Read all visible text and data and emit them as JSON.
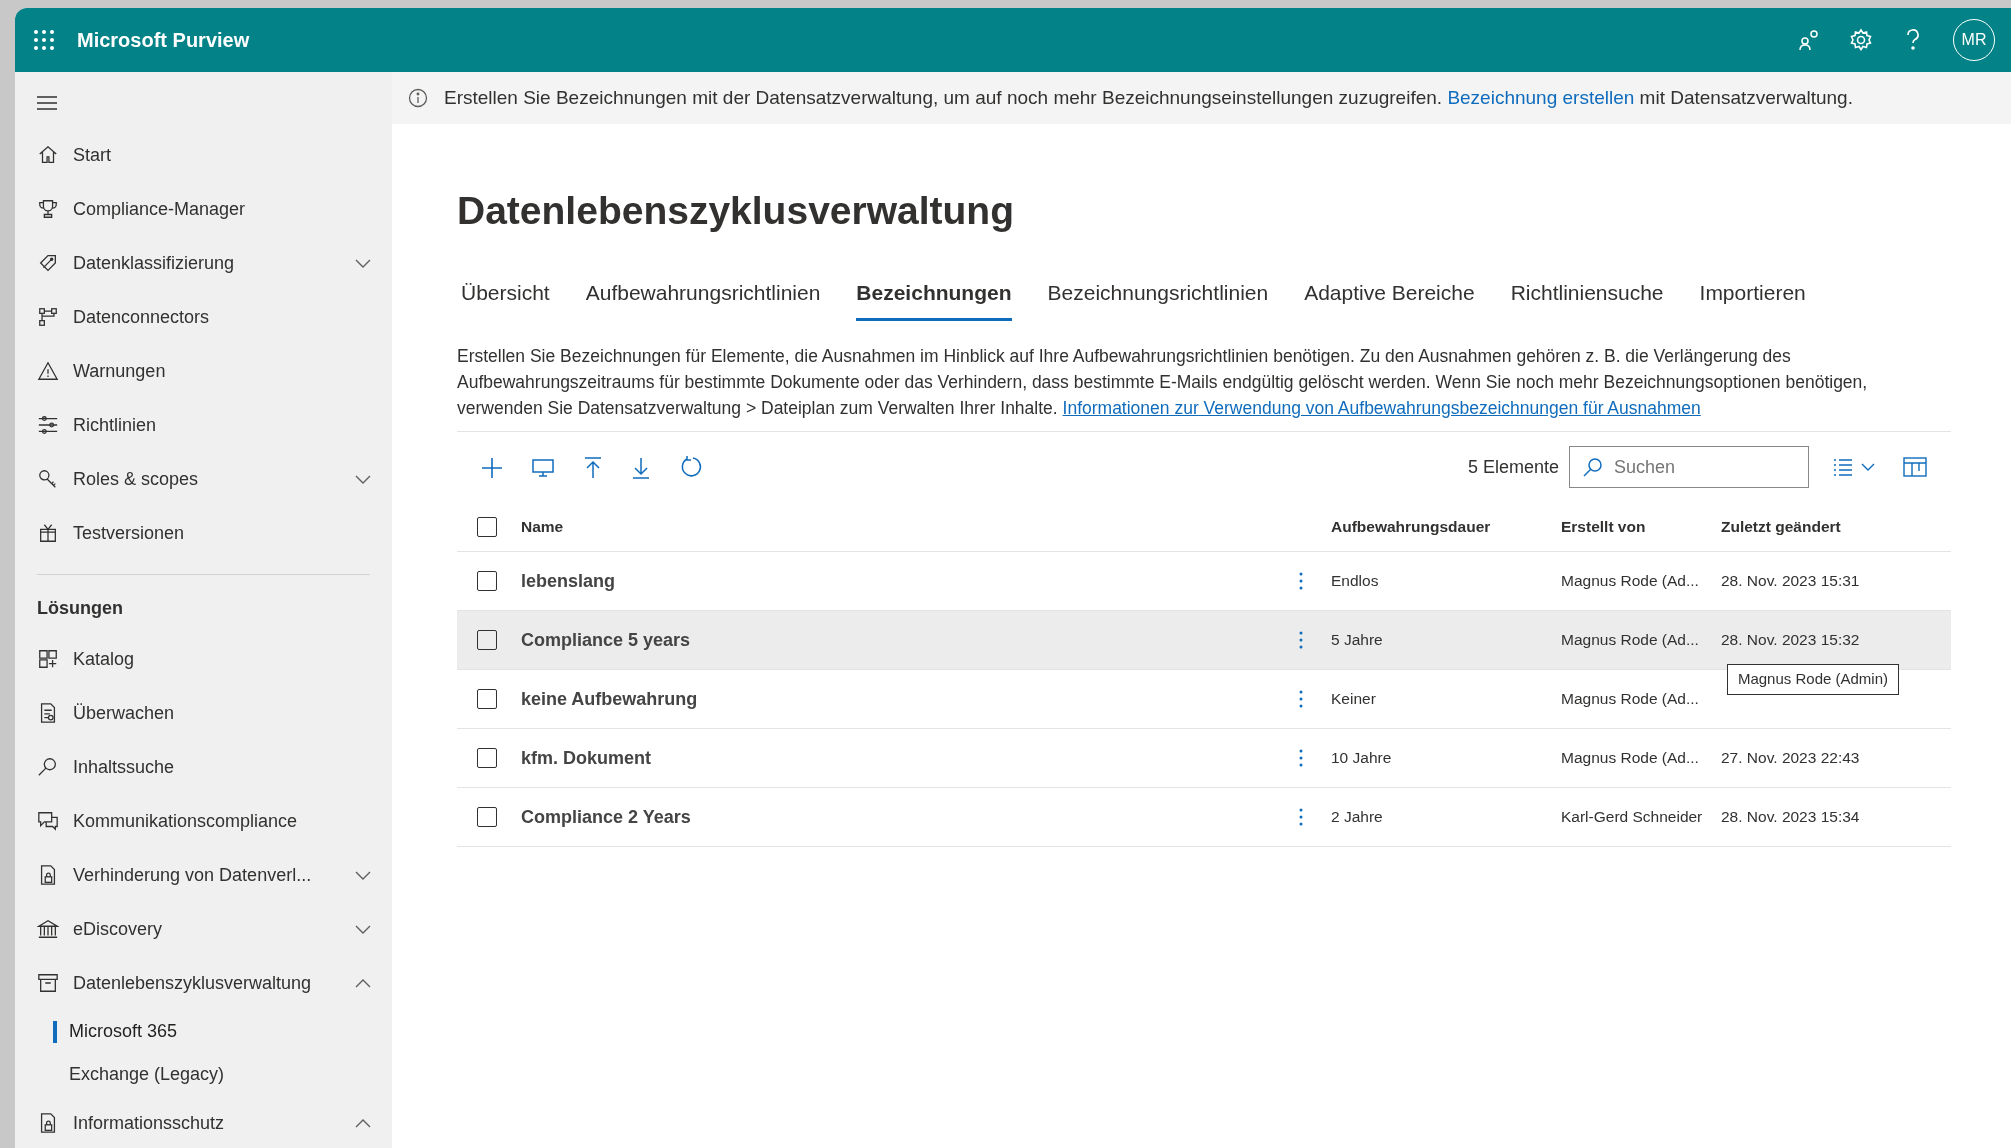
{
  "app": {
    "title": "Microsoft Purview",
    "avatar": "MR"
  },
  "sidebar": {
    "items": [
      {
        "label": "Start"
      },
      {
        "label": "Compliance-Manager"
      },
      {
        "label": "Datenklassifizierung",
        "expanded": false
      },
      {
        "label": "Datenconnectors"
      },
      {
        "label": "Warnungen"
      },
      {
        "label": "Richtlinien"
      },
      {
        "label": "Roles & scopes",
        "expanded": false
      },
      {
        "label": "Testversionen"
      }
    ],
    "section": "Lösungen",
    "solutions": [
      {
        "label": "Katalog"
      },
      {
        "label": "Überwachen"
      },
      {
        "label": "Inhaltssuche"
      },
      {
        "label": "Kommunikationscompliance"
      },
      {
        "label": "Verhinderung von Datenverl...",
        "expanded": false
      },
      {
        "label": "eDiscovery",
        "expanded": false
      },
      {
        "label": "Datenlebenszyklusverwaltung",
        "expanded": true,
        "children": [
          {
            "label": "Microsoft 365",
            "selected": true
          },
          {
            "label": "Exchange (Legacy)",
            "selected": false
          }
        ]
      },
      {
        "label": "Informationsschutz",
        "expanded": true
      }
    ]
  },
  "infobar": {
    "text": "Erstellen Sie Bezeichnungen mit der Datensatzverwaltung, um auf noch mehr Bezeichnungseinstellungen zuzugreifen.",
    "link": "Bezeichnung erstellen",
    "suffix": "mit Datensatzverwaltung."
  },
  "page_title": "Datenlebenszyklusverwaltung",
  "tabs": [
    {
      "label": "Übersicht",
      "selected": false
    },
    {
      "label": "Aufbewahrungsrichtlinien",
      "selected": false
    },
    {
      "label": "Bezeichnungen",
      "selected": true
    },
    {
      "label": "Bezeichnungsrichtlinien",
      "selected": false
    },
    {
      "label": "Adaptive Bereiche",
      "selected": false
    },
    {
      "label": "Richtliniensuche",
      "selected": false
    },
    {
      "label": "Importieren",
      "selected": false
    }
  ],
  "description": {
    "text": "Erstellen Sie Bezeichnungen für Elemente, die Ausnahmen im Hinblick auf Ihre Aufbewahrungsrichtlinien benötigen. Zu den Ausnahmen gehören z. B. die Verlängerung des Aufbewahrungszeitraums für bestimmte Dokumente oder das Verhindern, dass bestimmte E-Mails endgültig gelöscht werden. Wenn Sie noch mehr Bezeichnungsoptionen benötigen, verwenden Sie Datensatzverwaltung > Dateiplan zum Verwalten Ihrer Inhalte.",
    "link": "Informationen zur Verwendung von Aufbewahrungsbezeichnungen für Ausnahmen"
  },
  "toolbar": {
    "count": "5 Elemente",
    "search_placeholder": "Suchen"
  },
  "table": {
    "all_checked": false,
    "columns": [
      "Name",
      "Aufbewahrungsdauer",
      "Erstellt von",
      "Zuletzt geändert"
    ],
    "rows": [
      {
        "name": "lebenslang",
        "duration": "Endlos",
        "created_by": "Magnus Rode (Ad...",
        "modified": "28. Nov. 2023 15:31",
        "checked": false,
        "hovered": false
      },
      {
        "name": "Compliance 5 years",
        "duration": "5 Jahre",
        "created_by": "Magnus Rode (Ad...",
        "modified": "28. Nov. 2023 15:32",
        "checked": false,
        "hovered": true
      },
      {
        "name": "keine Aufbewahrung",
        "duration": "Keiner",
        "created_by": "Magnus Rode (Ad...",
        "checked": false,
        "hovered": false
      },
      {
        "name": "kfm. Dokument",
        "duration": "10 Jahre",
        "created_by": "Magnus Rode (Ad...",
        "modified": "27. Nov. 2023 22:43",
        "checked": false,
        "hovered": false
      },
      {
        "name": "Compliance 2 Years",
        "duration": "2 Jahre",
        "created_by": "Karl-Gerd Schneider",
        "modified": "28. Nov. 2023 15:34",
        "checked": false,
        "hovered": false
      }
    ]
  },
  "tooltip": "Magnus Rode (Admin)"
}
